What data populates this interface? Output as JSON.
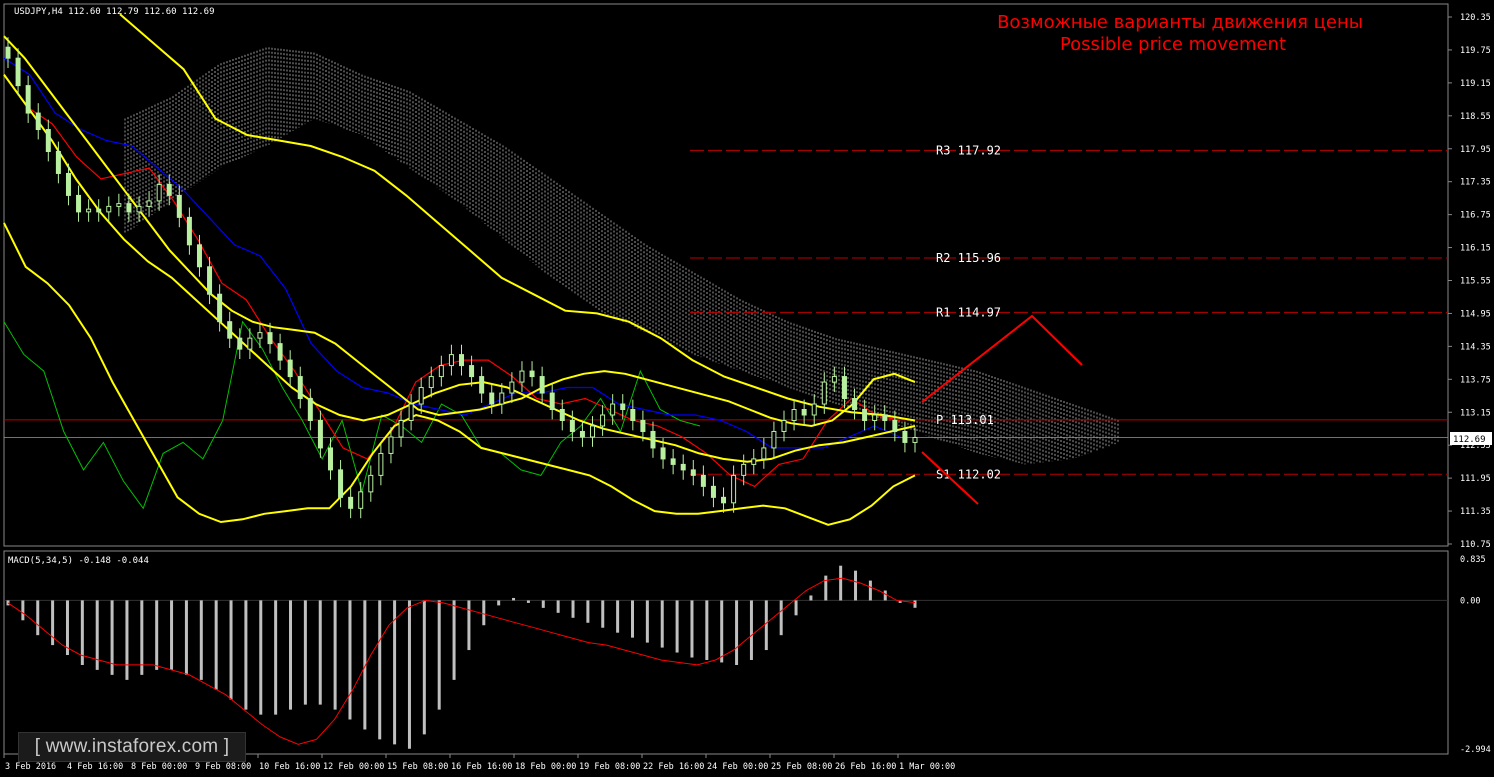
{
  "header": {
    "symbol_label": "USDJPY,H4  112.60 112.79 112.60 112.69",
    "indicator_label": "MACD(5,34,5) -0.148 -0.044"
  },
  "annotation": {
    "line_ru": "Возможные варианты движения цены",
    "line_en": "Possible price movement"
  },
  "levels": [
    {
      "name": "R3",
      "value": 117.92,
      "label": "R3 117.92"
    },
    {
      "name": "R2",
      "value": 115.96,
      "label": "R2 115.96"
    },
    {
      "name": "R1",
      "value": 114.97,
      "label": "R1 114.97"
    },
    {
      "name": "P",
      "value": 113.01,
      "label": "P 113.01"
    },
    {
      "name": "S1",
      "value": 112.02,
      "label": "S1 112.02"
    }
  ],
  "current_price": "112.69",
  "watermark": "[ www.instaforex.com ]",
  "colors": {
    "background": "#000000",
    "grid": "#555555",
    "candle": "#b8f0a0",
    "bollinger": "#ffff00",
    "tenkan": "#ff0000",
    "kijun": "#0000ff",
    "chikou": "#00c000",
    "cloud": "#ffffff",
    "annotation": "#ff0000",
    "macd_hist": "#c0c0c0",
    "macd_signal": "#ff0000"
  },
  "chart_data": [
    {
      "type": "line",
      "title": "USDJPY,H4",
      "ylim": [
        110.75,
        120.35
      ],
      "y_ticks": [
        "120.35",
        "119.75",
        "119.15",
        "118.55",
        "117.95",
        "117.35",
        "116.75",
        "116.15",
        "115.55",
        "114.95",
        "114.35",
        "113.75",
        "113.15",
        "112.55",
        "111.95",
        "111.35",
        "110.75"
      ],
      "x_ticks": [
        "3 Feb 2016",
        "4 Feb 16:00",
        "8 Feb 00:00",
        "9 Feb 08:00",
        "10 Feb 16:00",
        "12 Feb 00:00",
        "15 Feb 08:00",
        "16 Feb 16:00",
        "18 Feb 00:00",
        "19 Feb 08:00",
        "22 Feb 16:00",
        "24 Feb 00:00",
        "25 Feb 08:00",
        "26 Feb 16:00",
        "1 Mar 00:00"
      ],
      "close": [
        119.6,
        119.1,
        118.6,
        118.3,
        117.9,
        117.5,
        117.1,
        116.8,
        116.85,
        116.8,
        116.9,
        116.95,
        116.8,
        116.9,
        117.0,
        117.3,
        117.1,
        116.7,
        116.2,
        115.8,
        115.3,
        114.8,
        114.5,
        114.3,
        114.5,
        114.6,
        114.4,
        114.1,
        113.8,
        113.4,
        113.0,
        112.5,
        112.1,
        111.6,
        111.4,
        111.7,
        112.0,
        112.4,
        112.7,
        113.0,
        113.3,
        113.6,
        113.8,
        114.0,
        114.2,
        114.0,
        113.8,
        113.5,
        113.3,
        113.5,
        113.7,
        113.9,
        113.8,
        113.5,
        113.2,
        113.0,
        112.8,
        112.7,
        112.9,
        113.1,
        113.3,
        113.2,
        113.0,
        112.8,
        112.5,
        112.3,
        112.2,
        112.1,
        112.0,
        111.8,
        111.6,
        111.5,
        112.0,
        112.2,
        112.3,
        112.5,
        112.8,
        113.0,
        113.2,
        113.1,
        113.3,
        113.7,
        113.8,
        113.4,
        113.2,
        113.0,
        113.1,
        113.0,
        112.8,
        112.6,
        112.69
      ],
      "bollinger_upper": [
        120.0,
        119.6,
        119.1,
        118.6,
        118.1,
        117.6,
        117.1,
        116.6,
        116.1,
        115.7,
        115.3,
        115.0,
        114.8,
        114.7,
        114.65,
        114.6,
        114.4,
        114.1,
        113.8,
        113.5,
        113.2,
        113.1,
        113.15,
        113.2,
        113.3,
        113.4,
        113.6,
        113.75,
        113.85,
        113.9,
        113.85,
        113.75,
        113.65,
        113.55,
        113.45,
        113.35,
        113.2,
        113.05,
        112.95,
        112.9,
        113.0,
        113.3,
        113.75,
        113.85,
        113.7
      ],
      "bollinger_middle": [
        119.3,
        118.7,
        118.1,
        117.4,
        116.8,
        116.3,
        115.9,
        115.6,
        115.2,
        114.8,
        114.4,
        114.0,
        113.6,
        113.3,
        113.1,
        113.0,
        113.1,
        113.3,
        113.5,
        113.65,
        113.7,
        113.6,
        113.4,
        113.2,
        113.0,
        112.85,
        112.75,
        112.65,
        112.55,
        112.4,
        112.3,
        112.25,
        112.3,
        112.45,
        112.55,
        112.6,
        112.7,
        112.8,
        112.9
      ],
      "bollinger_lower": [
        116.6,
        115.8,
        115.5,
        115.1,
        114.5,
        113.7,
        113.0,
        112.3,
        111.6,
        111.3,
        111.15,
        111.2,
        111.3,
        111.35,
        111.4,
        111.4,
        111.8,
        112.4,
        112.9,
        113.1,
        113.0,
        112.8,
        112.5,
        112.4,
        112.3,
        112.2,
        112.1,
        112.0,
        111.8,
        111.55,
        111.35,
        111.3,
        111.3,
        111.35,
        111.4,
        111.45,
        111.4,
        111.25,
        111.1,
        111.2,
        111.45,
        111.8,
        112.0
      ],
      "bollinger_outer_upper": [
        120.4,
        119.9,
        119.4,
        118.5,
        118.2,
        118.1,
        118.0,
        117.8,
        117.55,
        117.1,
        116.6,
        116.1,
        115.6,
        115.3,
        115.0,
        114.95,
        114.8,
        114.5,
        114.1,
        113.8,
        113.6,
        113.4,
        113.25,
        113.15,
        113.1,
        113.0
      ]
    },
    {
      "type": "bar",
      "title": "MACD(5,34,5)",
      "ylim": [
        -2.994,
        0.835
      ],
      "y_ticks": [
        "0.835",
        "0.00",
        "-2.994"
      ],
      "values": [
        -0.1,
        -0.4,
        -0.7,
        -0.9,
        -1.1,
        -1.3,
        -1.4,
        -1.5,
        -1.6,
        -1.5,
        -1.4,
        -1.4,
        -1.5,
        -1.6,
        -1.8,
        -2.0,
        -2.2,
        -2.3,
        -2.3,
        -2.2,
        -2.1,
        -2.1,
        -2.2,
        -2.4,
        -2.6,
        -2.8,
        -2.9,
        -2.99,
        -2.7,
        -2.2,
        -1.6,
        -1.0,
        -0.5,
        -0.1,
        0.05,
        -0.05,
        -0.15,
        -0.25,
        -0.35,
        -0.45,
        -0.55,
        -0.65,
        -0.75,
        -0.85,
        -0.95,
        -1.05,
        -1.15,
        -1.2,
        -1.25,
        -1.3,
        -1.2,
        -1.0,
        -0.7,
        -0.3,
        0.1,
        0.5,
        0.7,
        0.6,
        0.4,
        0.2,
        -0.05,
        -0.148
      ],
      "signal": [
        -0.05,
        -0.3,
        -0.6,
        -0.9,
        -1.1,
        -1.2,
        -1.3,
        -1.3,
        -1.3,
        -1.4,
        -1.5,
        -1.7,
        -1.9,
        -2.2,
        -2.5,
        -2.75,
        -2.9,
        -2.8,
        -2.4,
        -1.8,
        -1.1,
        -0.5,
        -0.15,
        0.0,
        -0.05,
        -0.15,
        -0.25,
        -0.35,
        -0.45,
        -0.55,
        -0.65,
        -0.75,
        -0.85,
        -0.9,
        -1.0,
        -1.1,
        -1.2,
        -1.25,
        -1.3,
        -1.2,
        -1.0,
        -0.7,
        -0.4,
        -0.1,
        0.2,
        0.4,
        0.45,
        0.35,
        0.2,
        0.0,
        -0.044
      ]
    }
  ]
}
